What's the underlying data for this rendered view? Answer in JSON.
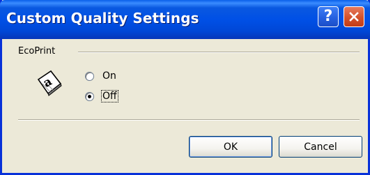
{
  "window": {
    "title": "Custom Quality Settings",
    "help_label": "?",
    "close_icon": "close-icon"
  },
  "group": {
    "label": "EcoPrint",
    "icon": "ecoprint-document-icon"
  },
  "options": [
    {
      "label": "On",
      "selected": false
    },
    {
      "label": "Off",
      "selected": true
    }
  ],
  "buttons": {
    "ok": "OK",
    "cancel": "Cancel"
  },
  "colors": {
    "titlebar": "#0050e6",
    "close_button": "#d3512a",
    "dialog_background": "#ece9d8"
  }
}
